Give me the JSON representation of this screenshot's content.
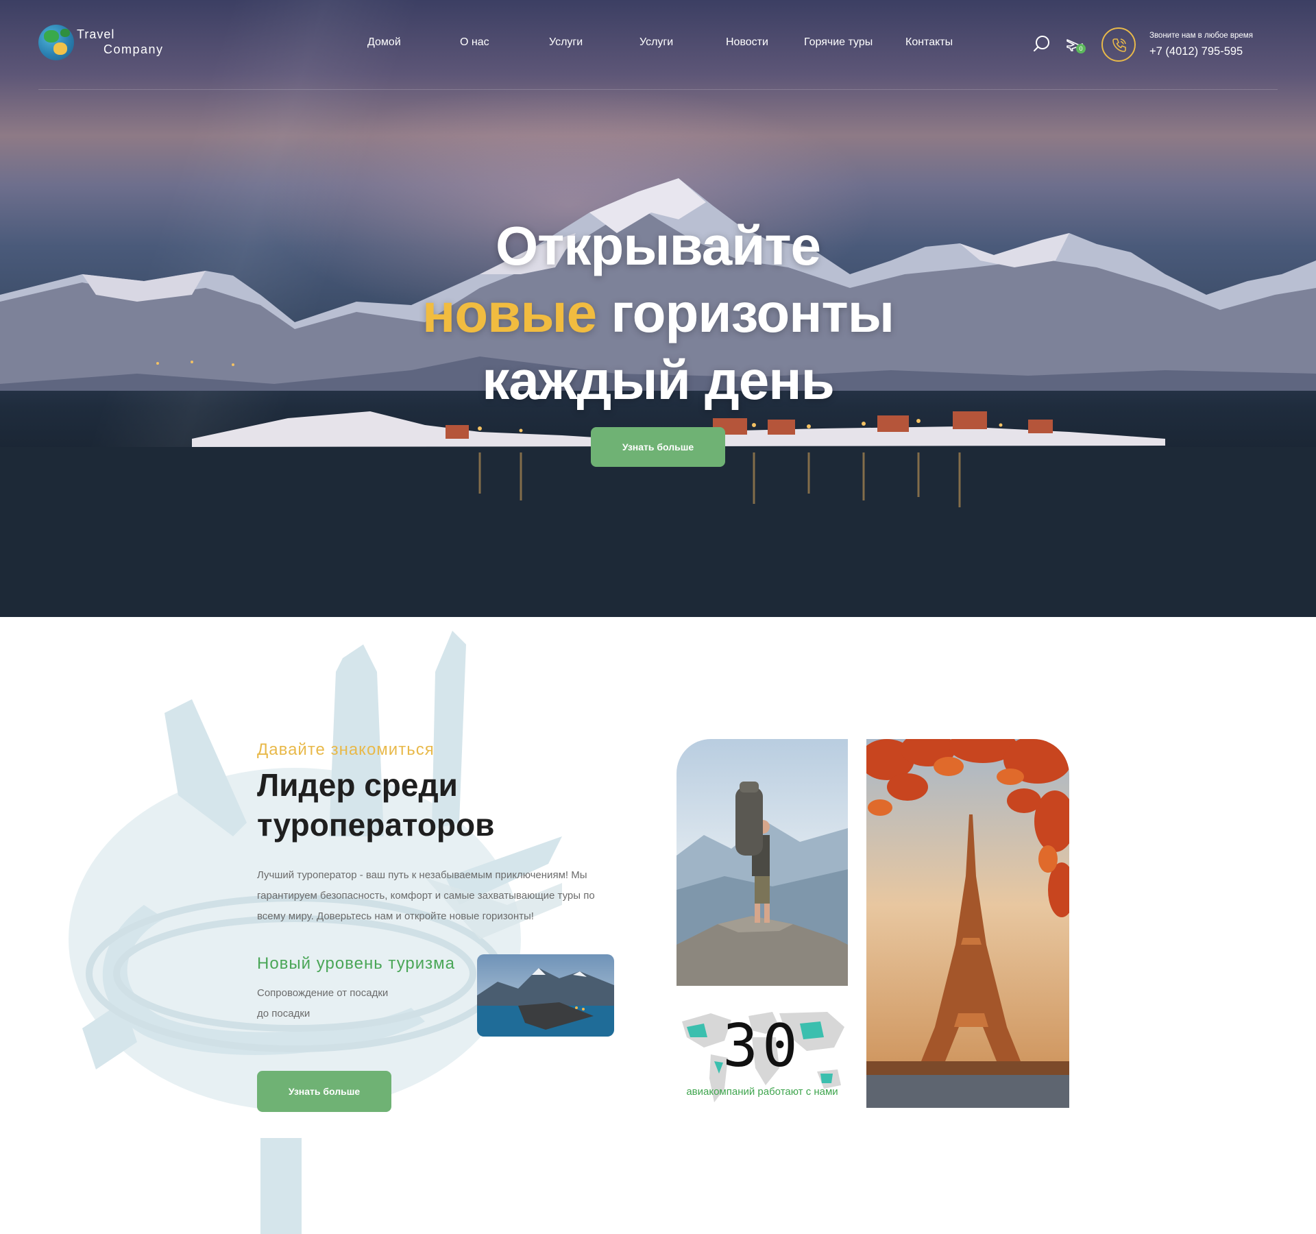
{
  "brand": {
    "line1": "Travel",
    "line2": "Company"
  },
  "nav": {
    "items": [
      {
        "label": "Домой"
      },
      {
        "label": "О нас"
      },
      {
        "label": "Услуги"
      },
      {
        "label": "Услуги"
      },
      {
        "label": "Новости"
      },
      {
        "label": "Горячие туры"
      },
      {
        "label": "Контакты"
      }
    ]
  },
  "header_actions": {
    "cart_count": "0",
    "call_label": "Звоните нам в любое время",
    "phone": "+7 (4012) 795-595",
    "accent_color": "#e8b94a"
  },
  "hero": {
    "line1": "Открывайте",
    "line2_highlight": "новые",
    "line2_rest": "горизонты",
    "line3": "каждый день",
    "button_label": "Узнать больше",
    "highlight_color": "#f1bc40",
    "button_color": "#6fb274"
  },
  "about": {
    "eyebrow": "Давайте знакомиться",
    "title_line1": "Лидер среди",
    "title_line2": "туроператоров",
    "text": "Лучший туроператор - ваш путь к незабываемым приключениям! Мы гарантируем безопасность, комфорт и самые захватывающие туры по всему миру. Доверьтесь нам и откройте новые горизонты!",
    "feature_title": "Новый уровень туризма",
    "feature_text": "Сопровождение от посадки до посадки",
    "button_label": "Узнать больше"
  },
  "stats": {
    "number": "30",
    "label": "авиакомпаний работают с нами"
  }
}
